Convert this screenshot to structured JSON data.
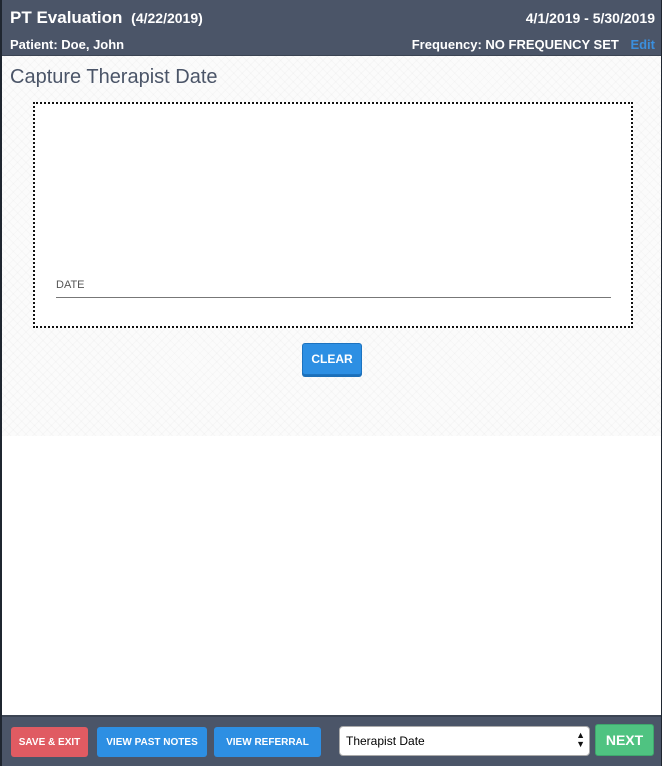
{
  "header": {
    "title": "PT Evaluation",
    "title_date": "(4/22/2019)",
    "date_range": "4/1/2019 - 5/30/2019",
    "patient_label": "Patient: Doe, John",
    "frequency_label": "Frequency: NO FREQUENCY SET",
    "edit_label": "Edit"
  },
  "main": {
    "heading": "Capture Therapist Date",
    "date_field_label": "DATE",
    "clear_label": "CLEAR"
  },
  "footer": {
    "save_exit_label": "SAVE & EXIT",
    "view_past_notes_label": "VIEW PAST NOTES",
    "view_referral_label": "VIEW REFERRAL",
    "section_select_value": "Therapist Date",
    "next_label": "NEXT"
  },
  "colors": {
    "header_bg": "#4b5568",
    "accent_blue": "#2d8fe3",
    "danger_red": "#e05b62",
    "success_green": "#4fc381"
  },
  "icons": {
    "select_arrows": "up-down-chevron-icon"
  }
}
